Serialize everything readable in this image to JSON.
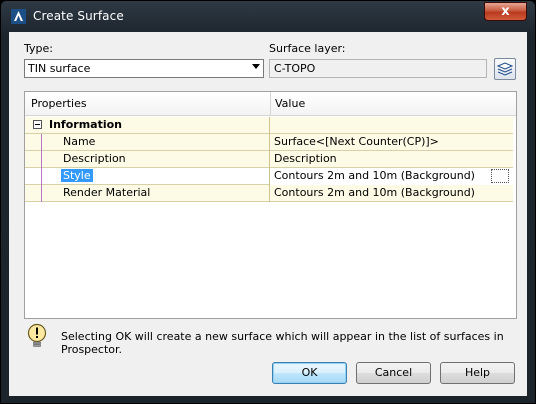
{
  "window": {
    "title": "Create Surface",
    "close_label": "x"
  },
  "type": {
    "label": "Type:",
    "value": "TIN surface"
  },
  "surface_layer": {
    "label": "Surface layer:",
    "value": "C-TOPO"
  },
  "grid": {
    "col_properties": "Properties",
    "col_value": "Value",
    "category": "Information",
    "rows": [
      {
        "key": "Name",
        "value": "Surface<[Next Counter(CP)]>"
      },
      {
        "key": "Description",
        "value": "Description"
      },
      {
        "key": "Style",
        "value": "Contours 2m and 10m (Background)"
      },
      {
        "key": "Render Material",
        "value": "Contours 2m and 10m (Background)"
      }
    ]
  },
  "message": "Selecting OK will create a new surface which will appear in the list of surfaces in Prospector.",
  "buttons": {
    "ok": "OK",
    "cancel": "Cancel",
    "help": "Help"
  },
  "icons": {
    "app": "civil3d-icon",
    "layer": "layers-icon",
    "warning": "lightbulb-warning-icon"
  }
}
